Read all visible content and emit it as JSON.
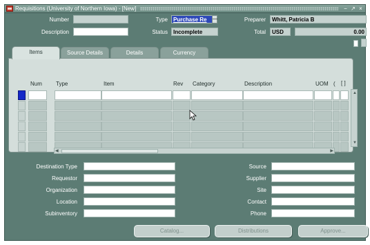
{
  "window": {
    "title": "Requisitions (University of Northern Iowa) - [New]",
    "controls": [
      "−",
      "↗",
      "×"
    ]
  },
  "header": {
    "number_label": "Number",
    "number_value": "",
    "description_label": "Description",
    "description_value": "",
    "type_label": "Type",
    "type_value": "Purchase Re",
    "status_label": "Status",
    "status_value": "Incomplete",
    "preparer_label": "Preparer",
    "preparer_value": "Whitt, Patricia B",
    "total_label": "Total",
    "currency_value": "USD",
    "total_value": "0.00"
  },
  "tabs": [
    {
      "label": "Items",
      "active": true
    },
    {
      "label": "Source Details",
      "active": false
    },
    {
      "label": "Details",
      "active": false
    },
    {
      "label": "Currency",
      "active": false
    }
  ],
  "grid": {
    "columns": [
      "Num",
      "Type",
      "Item",
      "Rev",
      "Category",
      "Description",
      "UOM",
      "("
    ],
    "flex_label": "[ ]",
    "row_count": 6
  },
  "detail_left": {
    "labels": [
      "Destination Type",
      "Requestor",
      "Organization",
      "Location",
      "Subinventory"
    ],
    "values": [
      "",
      "",
      "",
      "",
      ""
    ]
  },
  "detail_right": {
    "labels": [
      "Source",
      "Supplier",
      "Site",
      "Contact",
      "Phone"
    ],
    "values": [
      "",
      "",
      "",
      "",
      ""
    ]
  },
  "buttons": {
    "catalog": "Catalog...",
    "distributions": "Distributions",
    "approve": "Approve..."
  },
  "colors": {
    "window_bg": "#5c7c74",
    "panel_bg": "#d4dedb",
    "selected_field": "#2d48b8",
    "row_indicator": "#1428c8"
  }
}
